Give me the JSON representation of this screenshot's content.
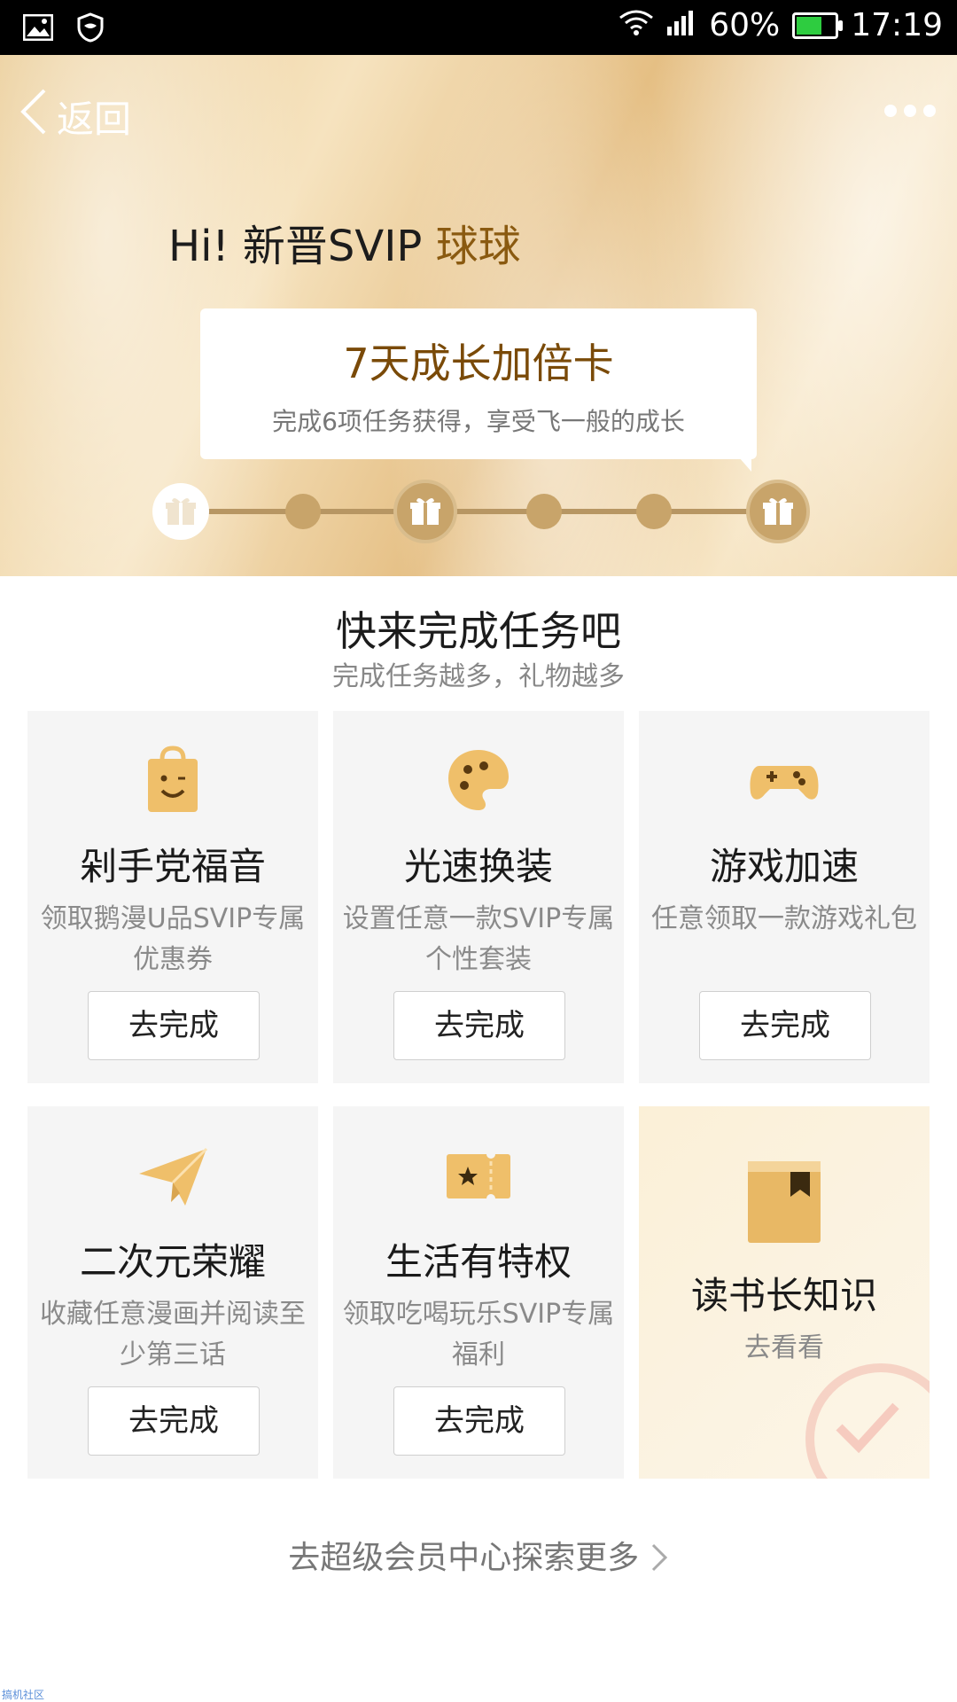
{
  "status_bar": {
    "battery_percent": "60%",
    "time": "17:19",
    "icons": [
      "image-icon",
      "shield-icon",
      "wifi-icon",
      "signal-icon",
      "battery-icon"
    ]
  },
  "header": {
    "back_label": "返回",
    "more_icon": "more-dots-icon"
  },
  "hero": {
    "greeting_prefix": "Hi! 新晋SVIP",
    "user_name": "球球",
    "card_title": "7天成长加倍卡",
    "card_subtitle": "完成6项任务获得，享受飞一般的成长",
    "progress": {
      "completed": 0,
      "total_steps": 6
    }
  },
  "section": {
    "title": "快来完成任务吧",
    "subtitle": "完成任务越多，礼物越多"
  },
  "tasks": [
    {
      "title": "剁手党福音",
      "desc": "领取鹅漫U品SVIP专属优惠券",
      "button": "去完成",
      "icon": "shopping-bag-smile-icon"
    },
    {
      "title": "光速换装",
      "desc": "设置任意一款SVIP专属个性套装",
      "button": "去完成",
      "icon": "palette-icon"
    },
    {
      "title": "游戏加速",
      "desc": "任意领取一款游戏礼包",
      "button": "去完成",
      "icon": "gamepad-icon"
    },
    {
      "title": "二次元荣耀",
      "desc": "收藏任意漫画并阅读至少第三话",
      "button": "去完成",
      "icon": "paper-plane-icon"
    },
    {
      "title": "生活有特权",
      "desc": "领取吃喝玩乐SVIP专属福利",
      "button": "去完成",
      "icon": "ticket-star-icon"
    },
    {
      "title": "读书长知识",
      "desc": "去看看",
      "icon": "book-bookmark-icon"
    }
  ],
  "footer": {
    "explore_label": "去超级会员中心探索更多",
    "watermark": "搞机社区"
  },
  "colors": {
    "accent_gold": "#c8a46a",
    "title_brown": "#7a4a08"
  }
}
